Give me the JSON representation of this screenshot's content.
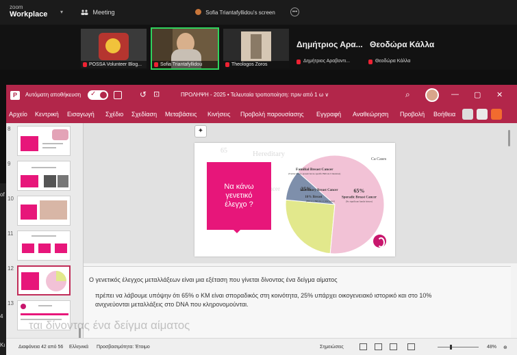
{
  "zoom": {
    "logo_small": "zoom",
    "logo_big": "Workplace",
    "meeting_label": "Meeting",
    "screen_label": "Sofia Triantafyllidou's screen"
  },
  "participants": [
    {
      "name": "POSSA Volunteer Blog..."
    },
    {
      "name": "Sofia Triantafyllidou"
    },
    {
      "name": "Theologos Zoros"
    }
  ],
  "participants_text_only": [
    {
      "name": "Δημήτριος Αρα...",
      "sub": "Δημήτριος Αραβοντι..."
    },
    {
      "name": "Θεοδώρα Κάλλα",
      "sub": "Θεοδώρα Κάλλα"
    }
  ],
  "ppt": {
    "app_letter": "P",
    "autosave_label": "Αυτόματη αποθήκευση",
    "doc_title": "ΠΡΟΛΗΨΗ - 2025 • Τελευταία τροποποίηση: πριν από 1 ω ∨",
    "menu": [
      "Αρχείο",
      "Κεντρική",
      "Εισαγωγή",
      "Σχέδιο",
      "Σχεδίαση",
      "Μεταβάσεις",
      "Κινήσεις",
      "Προβολή παρουσίασης",
      "Εγγραφή",
      "Αναθεώρηση",
      "Προβολή",
      "Βοήθεια"
    ],
    "window_controls": [
      "—",
      "▢",
      "✕"
    ]
  },
  "thumbnails": [
    {
      "num": "8"
    },
    {
      "num": "9"
    },
    {
      "num": "10"
    },
    {
      "num": "11"
    },
    {
      "num": "12"
    },
    {
      "num": "13"
    }
  ],
  "slide": {
    "box_text_line1": "Να κάνω",
    "box_text_line2": "γενετικό",
    "box_text_line3": "έλεγχο ?",
    "ghost_65": "65",
    "ghost_sporadic": "Sporadic Breast Cancer",
    "ghost_top": "Hereditary"
  },
  "chart_data": {
    "type": "pie",
    "title": "",
    "categories": [
      "Sporadic Breast Cancer",
      "Familial Breast Cancer",
      "Hereditary Breast Cancer"
    ],
    "values": [
      65,
      25,
      10
    ],
    "labels": [
      "65%",
      "25%",
      "10%"
    ],
    "sublabels": [
      "(No significant family history)",
      "(Family history present but no specific BRCA1/2 mutation)",
      "(BRCA1, BRCA2, or other genes)"
    ],
    "legend_title": "Ca Cases",
    "colors": [
      "#f2c2d6",
      "#e2e88c",
      "#7e8fab"
    ]
  },
  "notes": {
    "line1": "Ο γενετικός έλεγχος μεταλλάξεων είναι μια εξέταση που γίνεται δίνοντας ένα δείγμα αίματος",
    "line2": "πρέπει να λάβουμε υπόψην ότι 65% ο ΚΜ είναι σποραδικός στη κοινότητα, 25% υπάρχει οικογενειακό ιστορικό και στο 10%",
    "line3": "ανιχνεύονται μεταλλάξεις στο DNA που κληρονομούνται."
  },
  "status": {
    "slide_of": "Διαφάνεια 42 από 56",
    "language": "Ελληνικά",
    "accessibility": "Προσβασιμότητα: Έτοιμο",
    "notes_btn": "Σημειώσεις",
    "zoom_pct": "48%"
  },
  "caption_ghost": "ται δίνοντας ένα δείγμα αίματος",
  "left_frags": [
    "of",
    "4",
    "Κι"
  ]
}
